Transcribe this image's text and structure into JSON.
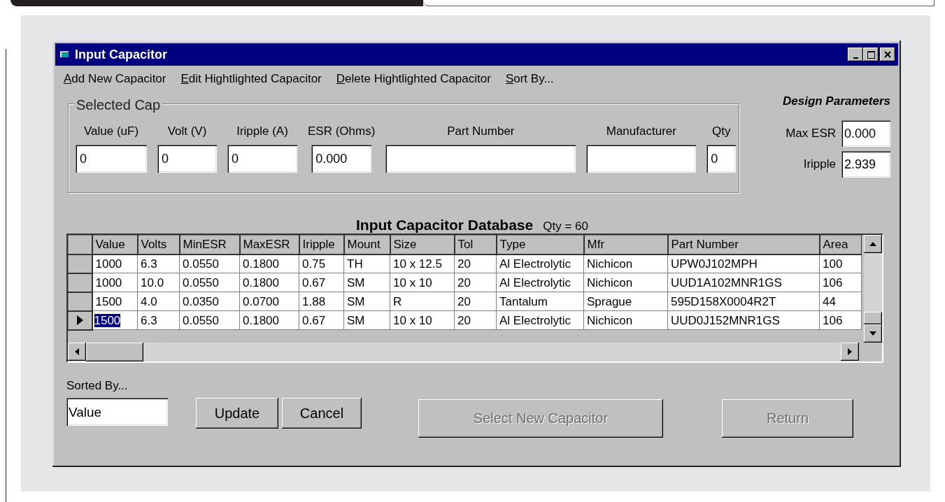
{
  "window": {
    "title": "Input Capacitor"
  },
  "menu": [
    {
      "label": "Add New Capacitor",
      "mnemonic": true
    },
    {
      "label": "Edit Hightlighted Capacitor",
      "mnemonic": true
    },
    {
      "label": "Delete Hightlighted Capacitor",
      "mnemonic": true
    },
    {
      "label": "Sort By...",
      "mnemonic": true
    }
  ],
  "selected_cap": {
    "title": "Selected Cap",
    "fields": [
      {
        "label": "Value (uF)",
        "value": "0"
      },
      {
        "label": "Volt (V)",
        "value": "0"
      },
      {
        "label": "Iripple (A)",
        "value": "0"
      },
      {
        "label": "ESR (Ohms)",
        "value": "0.000"
      },
      {
        "label": "Part Number"
      },
      {
        "label": "Manufacturer"
      },
      {
        "label": "Qty",
        "value": "0"
      }
    ]
  },
  "design_parameters": {
    "title": "Design Parameters",
    "fields": [
      {
        "label": "Max ESR",
        "value": "0.000"
      },
      {
        "label": "Iripple",
        "value": "2.939"
      }
    ]
  },
  "database": {
    "title": "Input Capacitor Database",
    "count": "Qty =  60",
    "columns": [
      "Value",
      "Volts",
      "MinESR",
      "MaxESR",
      "Iripple",
      "Mount",
      "Size",
      "Tol",
      "Type",
      "Mfr",
      "Part Number",
      "Area"
    ],
    "rows": [
      {
        "selected": false,
        "cells": [
          "1000",
          "6.3",
          "0.0550",
          "0.1800",
          "0.75",
          "TH",
          "10 x 12.5",
          "20",
          "Al Electrolytic",
          "Nichicon",
          "UPW0J102MPH",
          "100"
        ]
      },
      {
        "selected": false,
        "cells": [
          "1000",
          "10.0",
          "0.0550",
          "0.1800",
          "0.67",
          "SM",
          "10 x 10",
          "20",
          "Al Electrolytic",
          "Nichicon",
          "UUD1A102MNR1GS",
          "106"
        ]
      },
      {
        "selected": false,
        "cells": [
          "1500",
          "4.0",
          "0.0350",
          "0.0700",
          "1.88",
          "SM",
          "R",
          "20",
          "Tantalum",
          "Sprague",
          "595D158X0004R2T",
          "44"
        ]
      },
      {
        "selected": true,
        "cells": [
          "1500",
          "6.3",
          "0.0550",
          "0.1800",
          "0.67",
          "SM",
          "10 x 10",
          "20",
          "Al Electrolytic",
          "Nichicon",
          "UUD0J152MNR1GS",
          "106"
        ]
      }
    ]
  },
  "sorted_by": {
    "label": "Sorted By...",
    "value": "Value"
  },
  "buttons": [
    {
      "label": "Update",
      "disabled": false
    },
    {
      "label": "Cancel",
      "disabled": false
    },
    {
      "label": "Select New Capacitor",
      "disabled": true
    },
    {
      "label": "Return",
      "disabled": true
    }
  ]
}
